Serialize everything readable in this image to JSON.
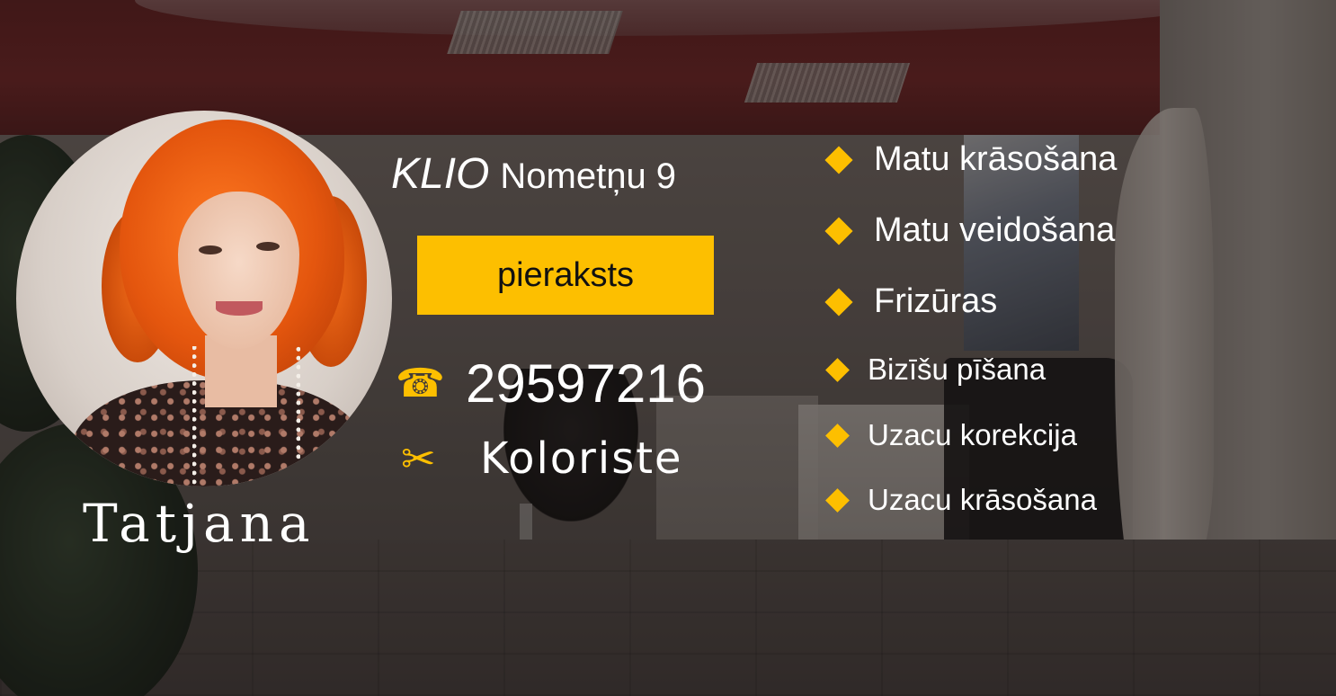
{
  "profile": {
    "name": "Tatjana",
    "role": "Koloriste"
  },
  "location": {
    "salon": "KLIO",
    "address": "Nometņu 9"
  },
  "booking": {
    "label": "pieraksts"
  },
  "contact": {
    "phone_icon": "☎",
    "phone": "29597216",
    "role_icon": "✂"
  },
  "icons": {
    "phone": "telephone-icon",
    "role": "scissors-icon",
    "bullet": "diamond-icon"
  },
  "services": [
    "Matu krāsošana",
    "Matu veidošana",
    "Frizūras",
    "Bizīšu pīšana",
    "Uzacu korekcija",
    "Uzacu krāsošana"
  ],
  "colors": {
    "accent": "#fdbf00",
    "text": "#ffffff",
    "button_text": "#111111"
  }
}
